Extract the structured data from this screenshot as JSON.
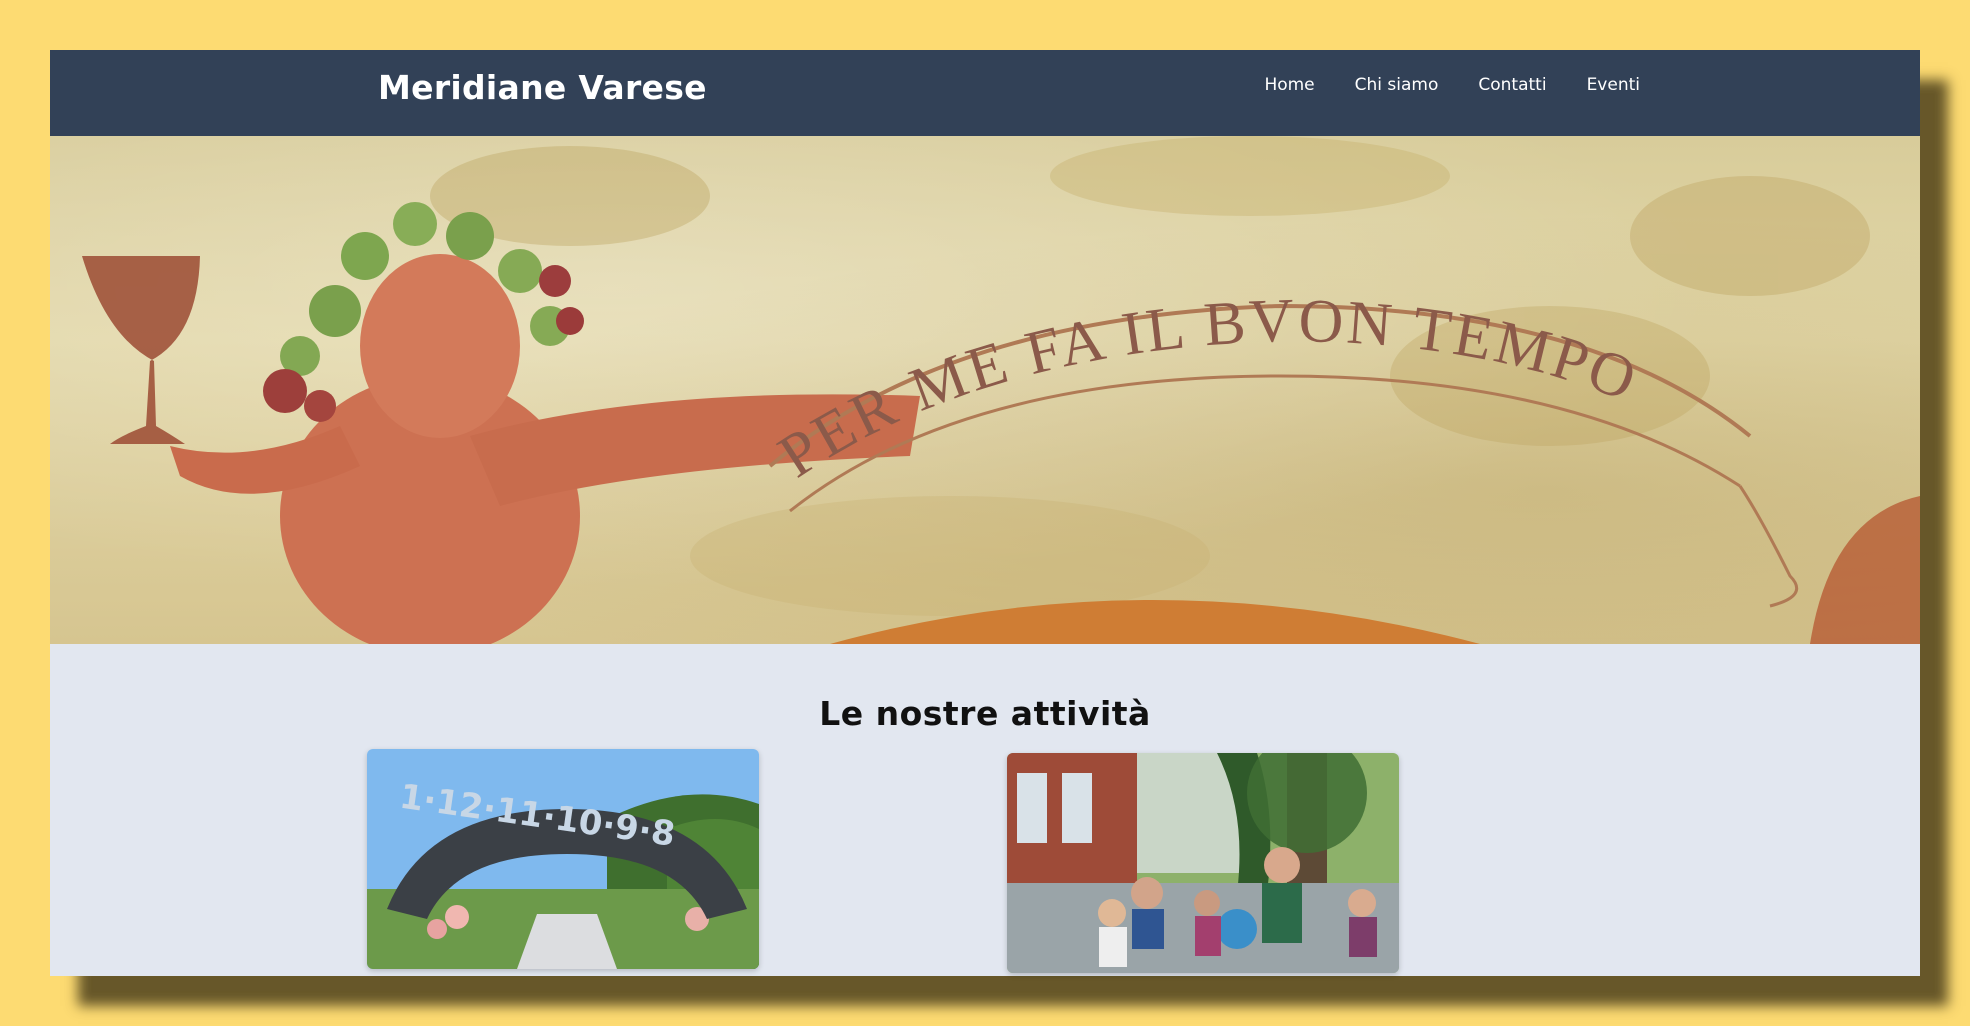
{
  "site": {
    "brand": "Meridiane Varese"
  },
  "nav": {
    "items": [
      {
        "label": "Home"
      },
      {
        "label": "Chi siamo"
      },
      {
        "label": "Contatti"
      },
      {
        "label": "Eventi"
      }
    ]
  },
  "hero": {
    "inscription": "PER ME FA IL BVON TEMPO"
  },
  "activities": {
    "title": "Le nostre attività",
    "cards": [
      {
        "dial_numbers": "1·12·11·10·9·8"
      },
      {}
    ]
  },
  "colors": {
    "page_background": "#fddb72",
    "navbar": "#324157",
    "content_background": "#e2e7f0"
  }
}
